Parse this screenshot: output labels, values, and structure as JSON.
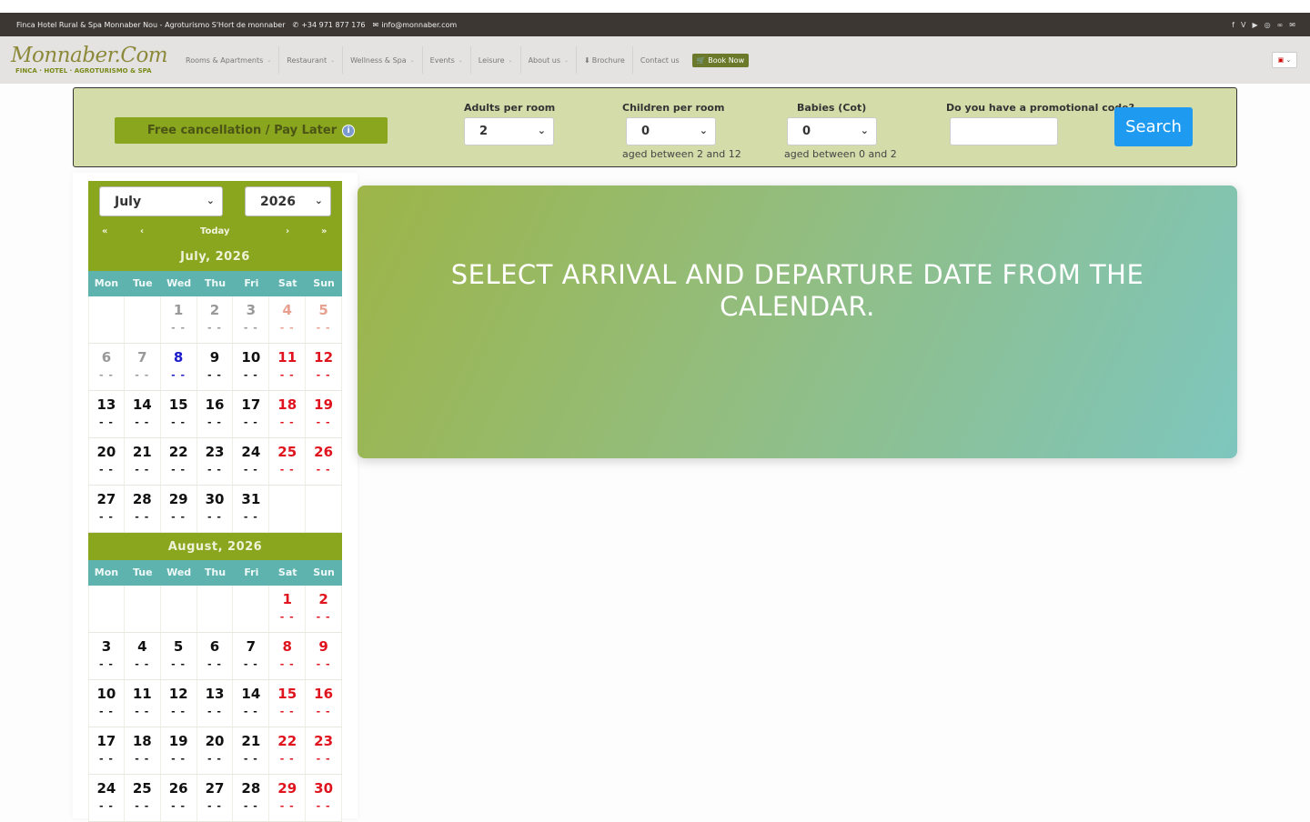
{
  "topbar": {
    "site": "Finca Hotel Rural & Spa Monnaber Nou - Agroturismo S'Hort de monnaber",
    "phone": "+34 971 877 176",
    "email": "info@monnaber.com",
    "social_icons": [
      "facebook-icon",
      "vimeo-icon",
      "youtube-icon",
      "instagram-icon",
      "tripadvisor-icon",
      "mail-icon"
    ]
  },
  "nav": {
    "logo_main": "Monnaber.Com",
    "logo_sub": "FINCA · HOTEL · AGROTURISMO & SPA",
    "items": [
      "Rooms & Apartments",
      "Restaurant",
      "Wellness & Spa",
      "Events",
      "Leisure",
      "About us",
      "Brochure",
      "Contact us"
    ],
    "book_now": "Book Now",
    "lang": "EN"
  },
  "search": {
    "free_cancel": "Free cancellation / Pay Later",
    "adults_label": "Adults per room",
    "adults_value": "2",
    "children_label": "Children per room",
    "children_value": "0",
    "children_hint": "aged between 2 and 12",
    "babies_label": "Babies (Cot)",
    "babies_value": "0",
    "babies_hint": "aged between 0 and 2",
    "promo_label": "Do you have a promotional code?",
    "search_button": "Search"
  },
  "calendar": {
    "month_select": "July",
    "year_select": "2026",
    "nav": {
      "first": "«",
      "prev": "‹",
      "today": "Today",
      "next": "›",
      "last": "»"
    },
    "weekdays": [
      "Mon",
      "Tue",
      "Wed",
      "Thu",
      "Fri",
      "Sat",
      "Sun"
    ],
    "empty_price": "- -",
    "months": [
      {
        "title": "July, 2026",
        "weeks": [
          [
            null,
            null,
            {
              "d": "1",
              "s": "past"
            },
            {
              "d": "2",
              "s": "past"
            },
            {
              "d": "3",
              "s": "past"
            },
            {
              "d": "4",
              "s": "pastwk"
            },
            {
              "d": "5",
              "s": "pastwk"
            }
          ],
          [
            {
              "d": "6",
              "s": "past"
            },
            {
              "d": "7",
              "s": "past"
            },
            {
              "d": "8",
              "s": "today"
            },
            {
              "d": "9",
              "s": "norm"
            },
            {
              "d": "10",
              "s": "norm"
            },
            {
              "d": "11",
              "s": "wk"
            },
            {
              "d": "12",
              "s": "wk"
            }
          ],
          [
            {
              "d": "13",
              "s": "norm"
            },
            {
              "d": "14",
              "s": "norm"
            },
            {
              "d": "15",
              "s": "norm"
            },
            {
              "d": "16",
              "s": "norm"
            },
            {
              "d": "17",
              "s": "norm"
            },
            {
              "d": "18",
              "s": "wk"
            },
            {
              "d": "19",
              "s": "wk"
            }
          ],
          [
            {
              "d": "20",
              "s": "norm"
            },
            {
              "d": "21",
              "s": "norm"
            },
            {
              "d": "22",
              "s": "norm"
            },
            {
              "d": "23",
              "s": "norm"
            },
            {
              "d": "24",
              "s": "norm"
            },
            {
              "d": "25",
              "s": "wk"
            },
            {
              "d": "26",
              "s": "wk"
            }
          ],
          [
            {
              "d": "27",
              "s": "norm"
            },
            {
              "d": "28",
              "s": "norm"
            },
            {
              "d": "29",
              "s": "norm"
            },
            {
              "d": "30",
              "s": "norm"
            },
            {
              "d": "31",
              "s": "norm"
            },
            null,
            null
          ]
        ]
      },
      {
        "title": "August, 2026",
        "weeks": [
          [
            null,
            null,
            null,
            null,
            null,
            {
              "d": "1",
              "s": "wk"
            },
            {
              "d": "2",
              "s": "wk"
            }
          ],
          [
            {
              "d": "3",
              "s": "norm"
            },
            {
              "d": "4",
              "s": "norm"
            },
            {
              "d": "5",
              "s": "norm"
            },
            {
              "d": "6",
              "s": "norm"
            },
            {
              "d": "7",
              "s": "norm"
            },
            {
              "d": "8",
              "s": "wk"
            },
            {
              "d": "9",
              "s": "wk"
            }
          ],
          [
            {
              "d": "10",
              "s": "norm"
            },
            {
              "d": "11",
              "s": "norm"
            },
            {
              "d": "12",
              "s": "norm"
            },
            {
              "d": "13",
              "s": "norm"
            },
            {
              "d": "14",
              "s": "norm"
            },
            {
              "d": "15",
              "s": "wk"
            },
            {
              "d": "16",
              "s": "wk"
            }
          ],
          [
            {
              "d": "17",
              "s": "norm"
            },
            {
              "d": "18",
              "s": "norm"
            },
            {
              "d": "19",
              "s": "norm"
            },
            {
              "d": "20",
              "s": "norm"
            },
            {
              "d": "21",
              "s": "norm"
            },
            {
              "d": "22",
              "s": "wk"
            },
            {
              "d": "23",
              "s": "wk"
            }
          ],
          [
            {
              "d": "24",
              "s": "norm"
            },
            {
              "d": "25",
              "s": "norm"
            },
            {
              "d": "26",
              "s": "norm"
            },
            {
              "d": "27",
              "s": "norm"
            },
            {
              "d": "28",
              "s": "norm"
            },
            {
              "d": "29",
              "s": "wk"
            },
            {
              "d": "30",
              "s": "wk"
            }
          ]
        ]
      }
    ]
  },
  "banner": {
    "message": "SELECT ARRIVAL AND DEPARTURE DATE FROM THE CALENDAR."
  },
  "colors": {
    "accent_green": "#8aa51e",
    "weekday_teal": "#5fb3ae",
    "weekend_red": "#e0141e",
    "today_blue": "#1a1acc",
    "search_blue": "#1e9bf0"
  }
}
